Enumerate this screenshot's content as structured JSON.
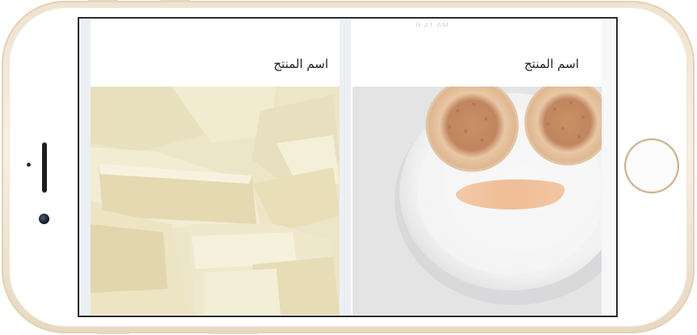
{
  "device": {
    "model": "iphone",
    "orientation": "landscape",
    "color": "gold"
  },
  "status_bar": {
    "time": "9:41 AM"
  },
  "products": [
    {
      "title": "اسم المنتج",
      "image_icon": "pancake-smiley-plate-image"
    },
    {
      "title": "اسم المنتج",
      "image_icon": "white-chocolate-image"
    }
  ],
  "colors": {
    "frame_gold": "#efe3cf",
    "home_ring": "#c9b291",
    "screen_border": "#2c2c2e",
    "gap_background": "#eceff4"
  }
}
